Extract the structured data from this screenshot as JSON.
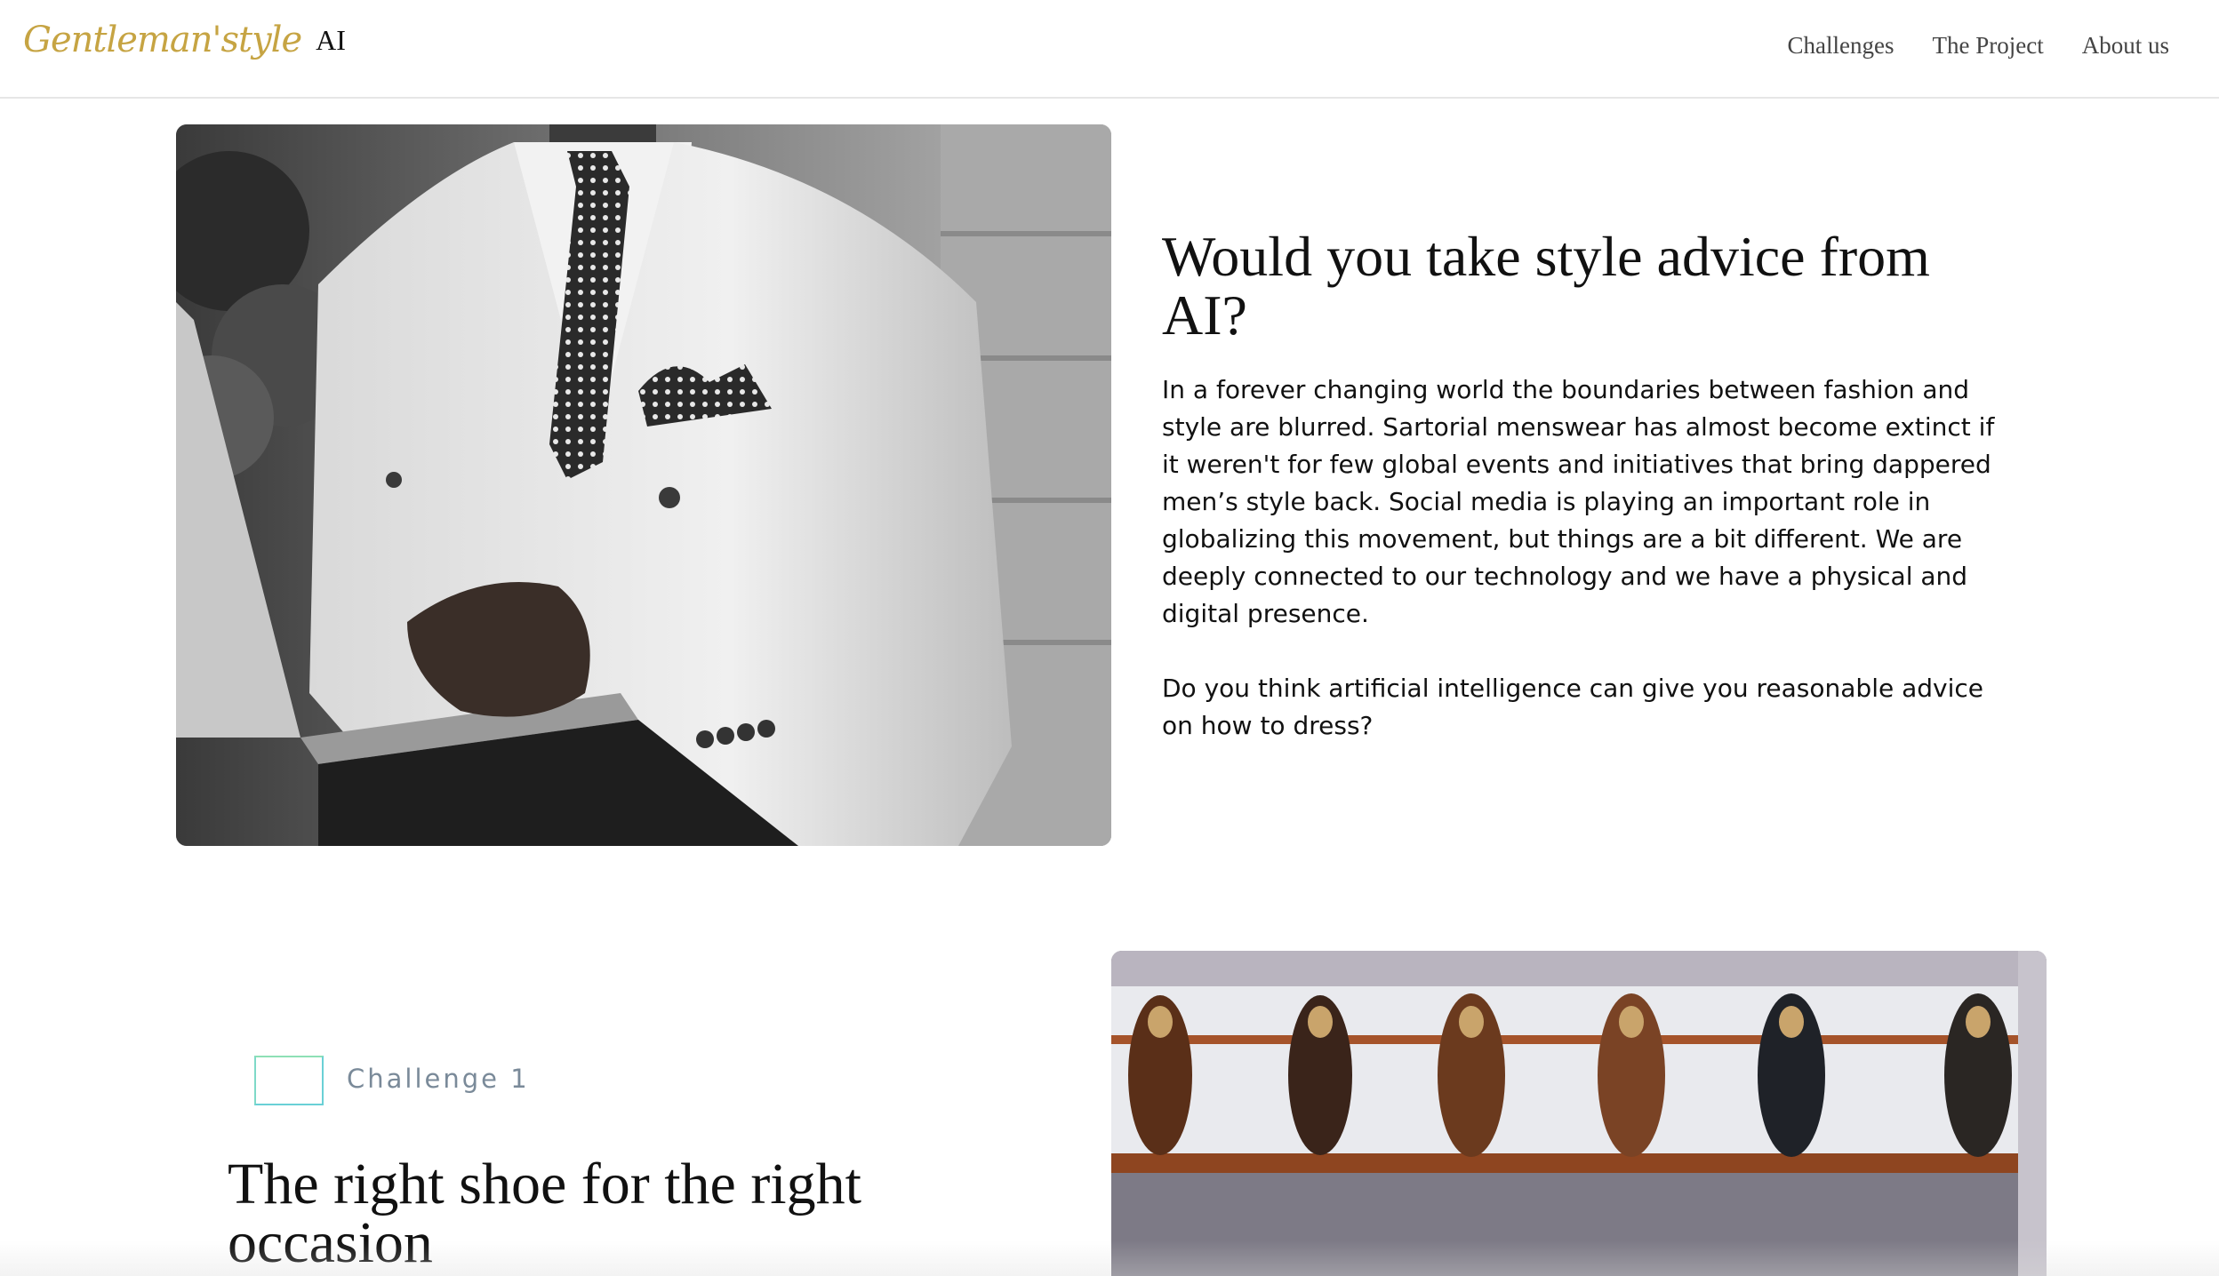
{
  "header": {
    "logo_script": "Gentleman'style",
    "logo_ai": "AI",
    "nav": [
      {
        "label": "Challenges"
      },
      {
        "label": "The Project"
      },
      {
        "label": "About us"
      }
    ]
  },
  "hero": {
    "image_alt": "",
    "title": "Would you take style advice from AI?",
    "paragraphs": [
      "In a forever changing world the boundaries between fashion and style are blurred. Sartorial menswear has almost become extinct if it weren't for few global events and initiatives that bring dappered men’s style back. Social media is playing an important role in globalizing this movement, but things are a bit different. We are deeply connected to our technology and we have a physical and digital presence.",
      "Do you think artificial intelligence can give you reasonable advice on how to dress?"
    ]
  },
  "challenge": {
    "label": "Challenge 1",
    "title": "The right shoe for the right occasion",
    "colors": {
      "badge_border": "#6ad0d6",
      "label": "#7a8a99"
    }
  },
  "colors": {
    "logo_gold": "#c6a443",
    "nav_text": "#444444",
    "header_border": "#e6e6e6"
  }
}
